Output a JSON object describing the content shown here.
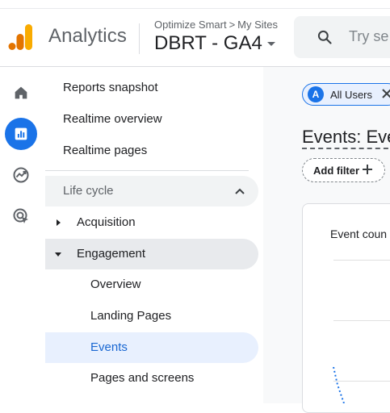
{
  "header": {
    "app_title": "Analytics",
    "breadcrumb": {
      "account": "Optimize Smart",
      "separator": ">",
      "section": "My Sites"
    },
    "property": "DBRT - GA4",
    "search_placeholder": "Try se"
  },
  "rail": {
    "items": [
      {
        "icon": "home-icon",
        "active": false
      },
      {
        "icon": "reports-icon",
        "active": true
      },
      {
        "icon": "explore-icon",
        "active": false
      },
      {
        "icon": "advertising-icon",
        "active": false
      }
    ]
  },
  "nav": {
    "items": [
      "Reports snapshot",
      "Realtime overview",
      "Realtime pages"
    ],
    "section": "Life cycle",
    "groups": [
      {
        "label": "Acquisition",
        "expanded": false
      },
      {
        "label": "Engagement",
        "expanded": true
      }
    ],
    "engagement_items": [
      {
        "label": "Overview",
        "active": false
      },
      {
        "label": "Landing Pages",
        "active": false
      },
      {
        "label": "Events",
        "active": true
      },
      {
        "label": "Pages and screens",
        "active": false
      }
    ]
  },
  "main": {
    "segment_chip": {
      "avatar": "A",
      "label": "All Users"
    },
    "page_title": "Events: Eve",
    "add_filter": "Add filter",
    "card_title": "Event coun"
  },
  "colors": {
    "accent": "#1a73e8",
    "active_bg": "#e8f0fe",
    "logo_orange": "#f9ab00",
    "logo_dark_orange": "#e37400"
  }
}
